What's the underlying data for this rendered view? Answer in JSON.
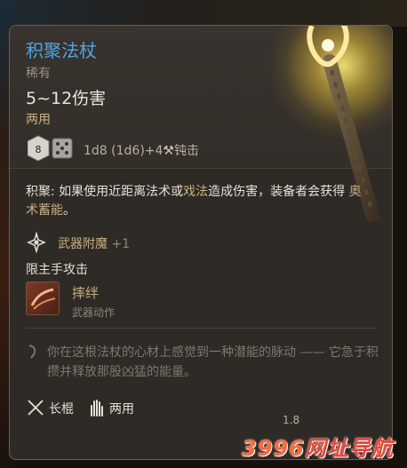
{
  "item": {
    "name": "积聚法杖",
    "rarity": "稀有",
    "damage": "5~12伤害",
    "handedness": "两用",
    "damage_formula": "1d8 (1d6)+4",
    "damage_type": "钝击",
    "dice_face": "8"
  },
  "description": {
    "label": "积聚:",
    "text_a": " 如果使用近距离法术或",
    "highlight_a": "戏法",
    "text_b": "造成伤害，装备者会获得 ",
    "highlight_b": "奥术蓄能",
    "text_c": "。"
  },
  "enchantment": {
    "label": "武器附魔",
    "bonus": "+1"
  },
  "restriction": "限主手攻击",
  "action": {
    "name": "摔绊",
    "type": "武器动作"
  },
  "flavor_text": "你在这根法杖的心材上感觉到一种潜能的脉动 —— 它急于积攒并释放那股凶猛的能量。",
  "footer": {
    "weapon_type": "长棍",
    "hand_use": "两用"
  },
  "weight": "1.8",
  "watermark": {
    "digits": "3996",
    "text": "网址导航"
  }
}
